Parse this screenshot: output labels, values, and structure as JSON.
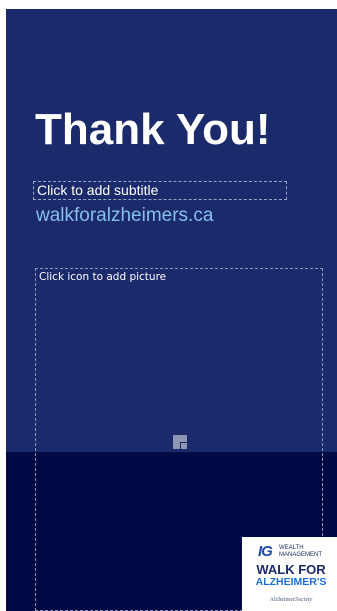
{
  "slide": {
    "title": "Thank You!",
    "subtitle_placeholder": "Click to add subtitle",
    "website": "walkforalzheimers.ca",
    "picture_placeholder": "Click icon to add picture",
    "picture_icon": "picture-insert-icon"
  },
  "logo": {
    "ig_mark": "IG",
    "ig_text": "WEALTH\nMANAGEMENT",
    "walk_line": "WALK FOR",
    "alz_line": "ALZHEIMER'S",
    "society_bold": "Alzheimer",
    "society_italic": "Society"
  },
  "colors": {
    "slide_background": "#1b2a6b",
    "slide_bottom_band": "#000a44",
    "title_text": "#ffffff",
    "website_text": "#87bff0",
    "logo_navy": "#1b2a6b",
    "logo_blue": "#1f6fd1"
  }
}
